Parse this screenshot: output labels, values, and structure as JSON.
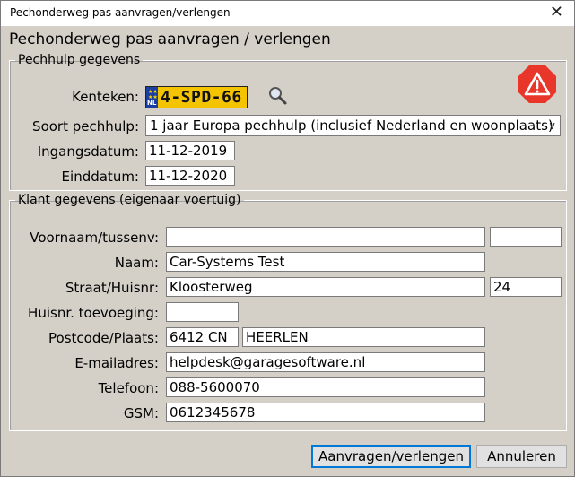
{
  "window": {
    "title": "Pechonderweg pas aanvragen/verlengen",
    "close_glyph": "✕"
  },
  "heading": "Pechonderweg pas aanvragen / verlengen",
  "pechhulp": {
    "legend": "Pechhulp gegevens",
    "kenteken_label": "Kenteken:",
    "kenteken_value": "4-SPD-66",
    "plate_country": "NL",
    "soort_label": "Soort pechhulp:",
    "soort_value": "1 jaar Europa pechhulp (inclusief Nederland en woonplaats)",
    "ingang_label": "Ingangsdatum:",
    "ingang_value": "11-12-2019",
    "eind_label": "Einddatum:",
    "eind_value": "11-12-2020",
    "icons": {
      "search": "magnifier-icon",
      "warning": "warning-octagon-icon"
    },
    "warning_color": "#e8362b"
  },
  "klant": {
    "legend": "Klant gegevens (eigenaar voertuig)",
    "voornaam_label": "Voornaam/tussenv:",
    "voornaam_value": "",
    "tussenv_value": "",
    "naam_label": "Naam:",
    "naam_value": "Car-Systems Test",
    "straat_label": "Straat/Huisnr:",
    "straat_value": "Kloosterweg",
    "huisnr_value": "24",
    "toev_label": "Huisnr. toevoeging:",
    "toev_value": "",
    "postcode_label": "Postcode/Plaats:",
    "postcode_value": "6412 CN",
    "plaats_value": "HEERLEN",
    "email_label": "E-mailadres:",
    "email_value": "helpdesk@garagesoftware.nl",
    "telefoon_label": "Telefoon:",
    "telefoon_value": "088-5600070",
    "gsm_label": "GSM:",
    "gsm_value": "0612345678"
  },
  "buttons": {
    "submit": "Aanvragen/verlengen",
    "cancel": "Annuleren"
  }
}
